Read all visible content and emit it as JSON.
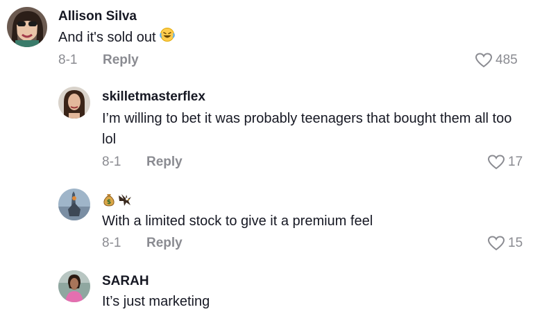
{
  "comments": [
    {
      "username": "Allison Silva",
      "text": "And it's sold out",
      "text_emoji": "laughing-tears-emoji",
      "date": "8-1",
      "reply_label": "Reply",
      "likes": "485"
    },
    {
      "username": "skilletmasterflex",
      "text": "I’m willing to bet it was probably teenagers that bought them all too lol",
      "date": "8-1",
      "reply_label": "Reply",
      "likes": "17"
    },
    {
      "username_emojis": [
        "money-bag-emoji",
        "eagle-emoji"
      ],
      "text": "With a limited stock to give it a premium feel",
      "date": "8-1",
      "reply_label": "Reply",
      "likes": "15"
    },
    {
      "username": "SARAH",
      "text": "It’s just marketing"
    }
  ],
  "colors": {
    "primary_text": "#161823",
    "secondary_text": "#8a8b91",
    "background": "#ffffff"
  }
}
